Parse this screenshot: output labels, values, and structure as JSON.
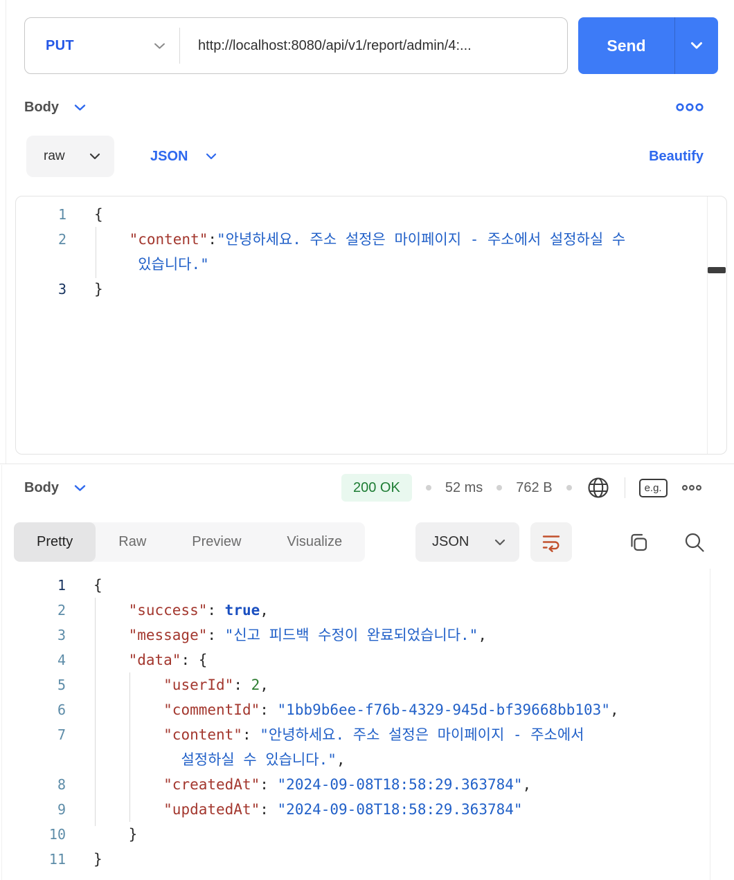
{
  "request": {
    "method": "PUT",
    "url": "http://localhost:8080/api/v1/report/admin/4:...",
    "send_label": "Send",
    "body_label": "Body",
    "mode": "raw",
    "language": "JSON",
    "beautify_label": "Beautify",
    "editor": {
      "lines": [
        {
          "num": "1",
          "active": false,
          "tokens": [
            {
              "t": "p",
              "v": "{"
            }
          ]
        },
        {
          "num": "2",
          "active": false,
          "tokens": [
            {
              "t": "p",
              "v": "    "
            },
            {
              "t": "k",
              "v": "\"content\""
            },
            {
              "t": "p",
              "v": ":"
            },
            {
              "t": "s",
              "v": "\"안녕하세요. 주소 설정은 마이페이지 - 주소에서 설정하실 수"
            }
          ]
        },
        {
          "num": "",
          "active": false,
          "tokens": [
            {
              "t": "p",
              "v": "     "
            },
            {
              "t": "s",
              "v": "있습니다.\""
            }
          ]
        },
        {
          "num": "3",
          "active": true,
          "tokens": [
            {
              "t": "p",
              "v": "}"
            }
          ]
        }
      ]
    }
  },
  "response": {
    "body_label": "Body",
    "status": "200 OK",
    "time": "52 ms",
    "size": "762 B",
    "eg_badge": "e.g.",
    "tabs": [
      "Pretty",
      "Raw",
      "Preview",
      "Visualize"
    ],
    "active_tab": "Pretty",
    "format": "JSON",
    "editor": {
      "lines": [
        {
          "num": "1",
          "active": true,
          "tokens": [
            {
              "t": "p",
              "v": "{"
            }
          ]
        },
        {
          "num": "2",
          "active": false,
          "tokens": [
            {
              "t": "p",
              "v": "    "
            },
            {
              "t": "k",
              "v": "\"success\""
            },
            {
              "t": "p",
              "v": ": "
            },
            {
              "t": "b",
              "v": "true"
            },
            {
              "t": "p",
              "v": ","
            }
          ]
        },
        {
          "num": "3",
          "active": false,
          "tokens": [
            {
              "t": "p",
              "v": "    "
            },
            {
              "t": "k",
              "v": "\"message\""
            },
            {
              "t": "p",
              "v": ": "
            },
            {
              "t": "s",
              "v": "\"신고 피드백 수정이 완료되었습니다.\""
            },
            {
              "t": "p",
              "v": ","
            }
          ]
        },
        {
          "num": "4",
          "active": false,
          "tokens": [
            {
              "t": "p",
              "v": "    "
            },
            {
              "t": "k",
              "v": "\"data\""
            },
            {
              "t": "p",
              "v": ": {"
            }
          ]
        },
        {
          "num": "5",
          "active": false,
          "tokens": [
            {
              "t": "p",
              "v": "        "
            },
            {
              "t": "k",
              "v": "\"userId\""
            },
            {
              "t": "p",
              "v": ": "
            },
            {
              "t": "n",
              "v": "2"
            },
            {
              "t": "p",
              "v": ","
            }
          ]
        },
        {
          "num": "6",
          "active": false,
          "tokens": [
            {
              "t": "p",
              "v": "        "
            },
            {
              "t": "k",
              "v": "\"commentId\""
            },
            {
              "t": "p",
              "v": ": "
            },
            {
              "t": "s",
              "v": "\"1bb9b6ee-f76b-4329-945d-bf39668bb103\""
            },
            {
              "t": "p",
              "v": ","
            }
          ]
        },
        {
          "num": "7",
          "active": false,
          "tokens": [
            {
              "t": "p",
              "v": "        "
            },
            {
              "t": "k",
              "v": "\"content\""
            },
            {
              "t": "p",
              "v": ": "
            },
            {
              "t": "s",
              "v": "\"안녕하세요. 주소 설정은 마이페이지 - 주소에서"
            }
          ]
        },
        {
          "num": "",
          "active": false,
          "tokens": [
            {
              "t": "p",
              "v": "          "
            },
            {
              "t": "s",
              "v": "설정하실 수 있습니다.\""
            },
            {
              "t": "p",
              "v": ","
            }
          ]
        },
        {
          "num": "8",
          "active": false,
          "tokens": [
            {
              "t": "p",
              "v": "        "
            },
            {
              "t": "k",
              "v": "\"createdAt\""
            },
            {
              "t": "p",
              "v": ": "
            },
            {
              "t": "s",
              "v": "\"2024-09-08T18:58:29.363784\""
            },
            {
              "t": "p",
              "v": ","
            }
          ]
        },
        {
          "num": "9",
          "active": false,
          "tokens": [
            {
              "t": "p",
              "v": "        "
            },
            {
              "t": "k",
              "v": "\"updatedAt\""
            },
            {
              "t": "p",
              "v": ": "
            },
            {
              "t": "s",
              "v": "\"2024-09-08T18:58:29.363784\""
            }
          ]
        },
        {
          "num": "10",
          "active": false,
          "tokens": [
            {
              "t": "p",
              "v": "    }"
            }
          ]
        },
        {
          "num": "11",
          "active": false,
          "tokens": [
            {
              "t": "p",
              "v": "}"
            }
          ]
        }
      ]
    }
  },
  "colors": {
    "accent_blue": "#2d68ee",
    "send_button": "#3d7bf7",
    "status_green": "#1e7d34",
    "status_pill_bg": "#e9f8ef",
    "json_key_red": "#a3372e",
    "json_string_blue": "#2160c8",
    "json_bool_blue": "#1a4fc0",
    "json_number_green": "#2e7d32",
    "wrap_icon_orange": "#c2512d",
    "line_number_teal": "#5d8ca8"
  }
}
